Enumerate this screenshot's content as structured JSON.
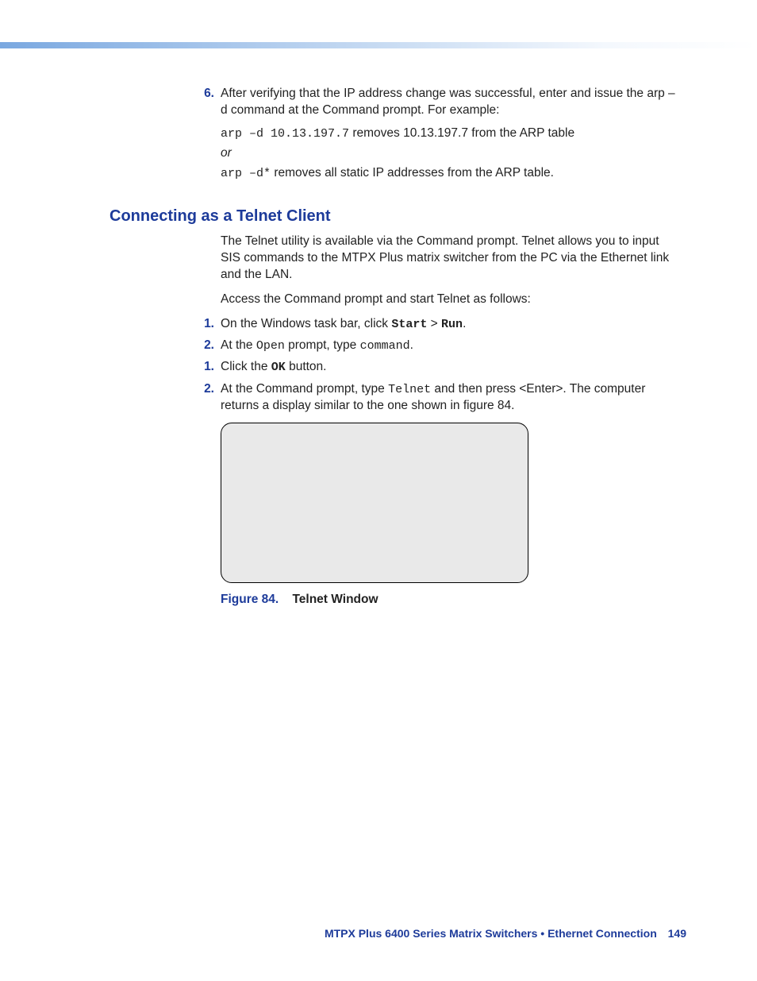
{
  "top_list": {
    "item6": {
      "num": "6.",
      "text": "After verifying that the IP address change was successful, enter and issue the arp –d command at the Command prompt. For example:",
      "ex1_code": "arp –d 10.13.197.7",
      "ex1_tail": " removes 10.13.197.7 from the ARP table",
      "or": "or",
      "ex2_code": "arp –d*",
      "ex2_tail": " removes all static IP addresses from the ARP table."
    }
  },
  "heading": "Connecting as a Telnet Client",
  "intro1": "The Telnet utility is available via the Command prompt. Telnet allows you to input SIS commands to the MTPX Plus matrix switcher from the PC via the Ethernet link and the LAN.",
  "intro2": "Access the Command prompt and start Telnet as follows:",
  "steps": {
    "s1": {
      "num": "1.",
      "pre": "On the Windows task bar, click ",
      "start": "Start",
      "gt": " > ",
      "run": "Run",
      "post": "."
    },
    "s2": {
      "num": "2.",
      "pre": "At the ",
      "open": "Open",
      "mid": " prompt, type ",
      "command": "command",
      "post": "."
    },
    "s3": {
      "num": "1.",
      "pre": "Click the ",
      "ok": "OK",
      "post": " button."
    },
    "s4": {
      "num": "2.",
      "pre": "At the Command prompt, type ",
      "telnet": "Telnet",
      "post": " and then press <Enter>. The computer returns a display similar to the one shown in figure 84."
    }
  },
  "figure": {
    "label": "Figure 84.",
    "title": "Telnet Window"
  },
  "footer": {
    "text": "MTPX Plus 6400 Series Matrix Switchers • Ethernet Connection",
    "page": "149"
  }
}
